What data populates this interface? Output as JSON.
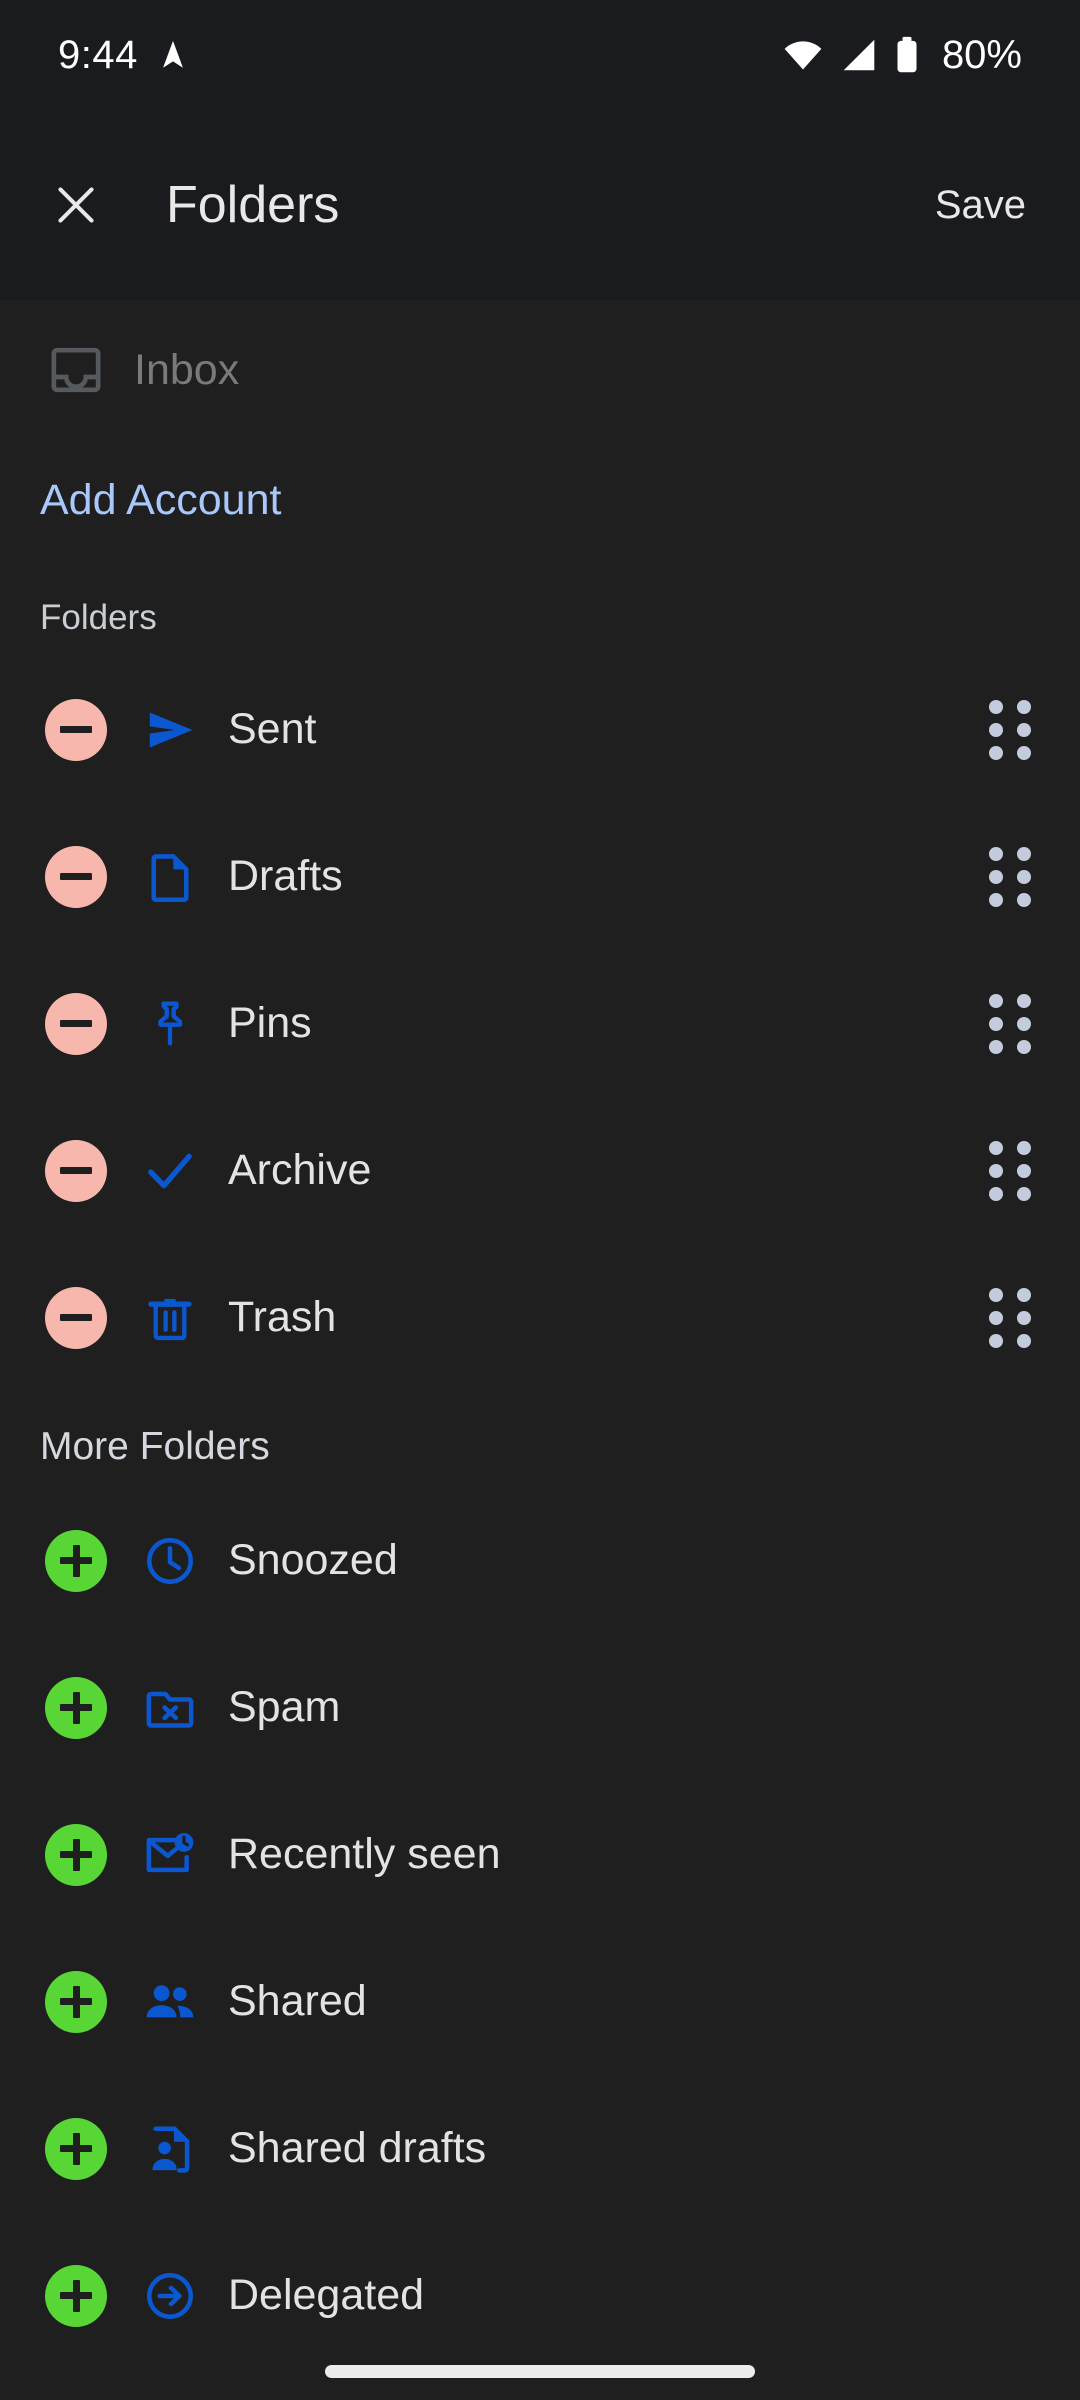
{
  "status_bar": {
    "time": "9:44",
    "location_icon": "navigation-arrow-icon",
    "wifi_icon": "wifi-icon",
    "signal_icon": "cellular-signal-icon",
    "battery_icon": "battery-icon",
    "battery_percent": "80%"
  },
  "app_bar": {
    "close_icon": "close-icon",
    "title": "Folders",
    "save_label": "Save"
  },
  "account": {
    "inbox_label": "Inbox",
    "inbox_icon": "inbox-tray-icon",
    "inbox_disabled": true,
    "add_account_label": "Add Account"
  },
  "sections": [
    {
      "heading": "Folders",
      "action": "remove",
      "action_icon": "minus-circle-icon",
      "action_color": "#f7b7ad",
      "items": [
        {
          "label": "Sent",
          "icon": "send-icon",
          "handle_icon": "drag-handle-icon"
        },
        {
          "label": "Drafts",
          "icon": "document-icon",
          "handle_icon": "drag-handle-icon"
        },
        {
          "label": "Pins",
          "icon": "pin-icon",
          "handle_icon": "drag-handle-icon"
        },
        {
          "label": "Archive",
          "icon": "check-icon",
          "handle_icon": "drag-handle-icon"
        },
        {
          "label": "Trash",
          "icon": "trash-icon",
          "handle_icon": "drag-handle-icon"
        }
      ]
    },
    {
      "heading": "More Folders",
      "action": "add",
      "action_icon": "plus-circle-icon",
      "action_color": "#58d636",
      "items": [
        {
          "label": "Snoozed",
          "icon": "clock-icon"
        },
        {
          "label": "Spam",
          "icon": "folder-x-icon"
        },
        {
          "label": "Recently seen",
          "icon": "mail-clock-icon"
        },
        {
          "label": "Shared",
          "icon": "people-icon"
        },
        {
          "label": "Shared drafts",
          "icon": "document-person-icon"
        },
        {
          "label": "Delegated",
          "icon": "arrow-circle-right-icon"
        }
      ]
    }
  ],
  "colors": {
    "background": "#1f1f1f",
    "app_bar_background": "#1a1b1e",
    "accent_blue": "#0b57d0",
    "link_blue": "#a8c7fa",
    "remove_pink": "#f7b7ad",
    "add_green": "#58d636",
    "text_primary": "#e3e3e3",
    "text_disabled": "#7a7a7a"
  },
  "navigation": {
    "home_indicator": "home-indicator"
  }
}
